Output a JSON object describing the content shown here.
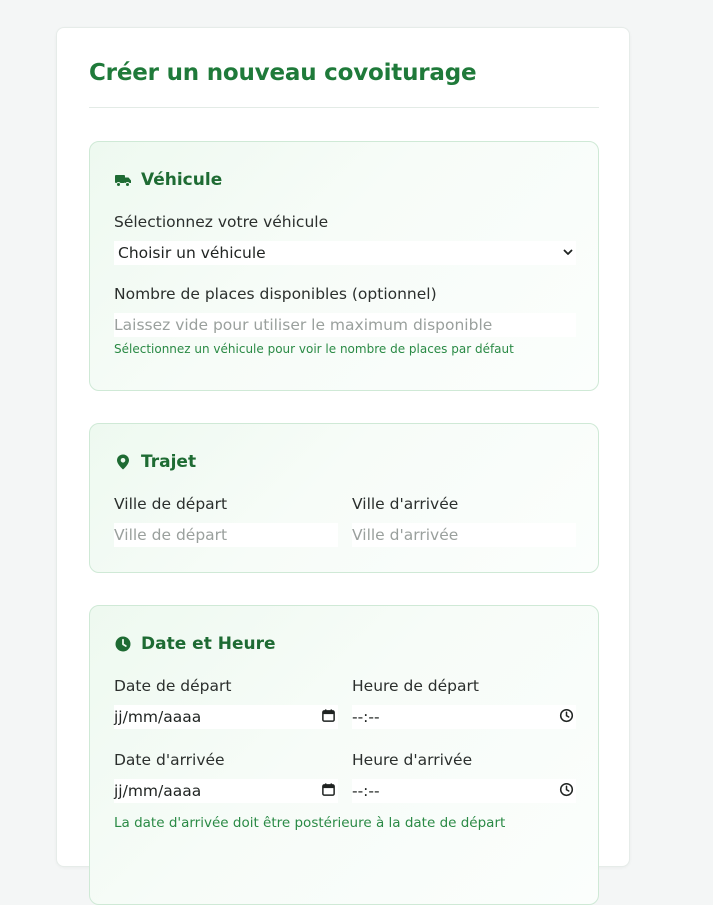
{
  "form": {
    "title": "Créer un nouveau covoiturage"
  },
  "vehicle_section": {
    "title": "Véhicule",
    "icon": "truck-icon",
    "select_label": "Sélectionnez votre véhicule",
    "select_value": "Choisir un véhicule",
    "seats_label": "Nombre de places disponibles (optionnel)",
    "seats_placeholder": "Laissez vide pour utiliser le maximum disponible",
    "seats_help": "Sélectionnez un véhicule pour voir le nombre de places par défaut"
  },
  "route_section": {
    "title": "Trajet",
    "icon": "location-pin-icon",
    "departure_label": "Ville de départ",
    "departure_placeholder": "Ville de départ",
    "arrival_label": "Ville d'arrivée",
    "arrival_placeholder": "Ville d'arrivée"
  },
  "datetime_section": {
    "title": "Date et Heure",
    "icon": "clock-icon",
    "departure_date_label": "Date de départ",
    "departure_date_value": "jj/mm/aaaa",
    "departure_time_label": "Heure de départ",
    "departure_time_value": "--:--",
    "arrival_date_label": "Date d'arrivée",
    "arrival_date_value": "jj/mm/aaaa",
    "arrival_time_label": "Heure d'arrivée",
    "arrival_time_value": "--:--",
    "help": "La date d'arrivée doit être postérieure à la date de départ"
  },
  "colors": {
    "accent": "#1f7a3a",
    "section_bg": "#eef9f0",
    "section_border": "#cfe9d6",
    "help_text": "#2a8a45"
  }
}
